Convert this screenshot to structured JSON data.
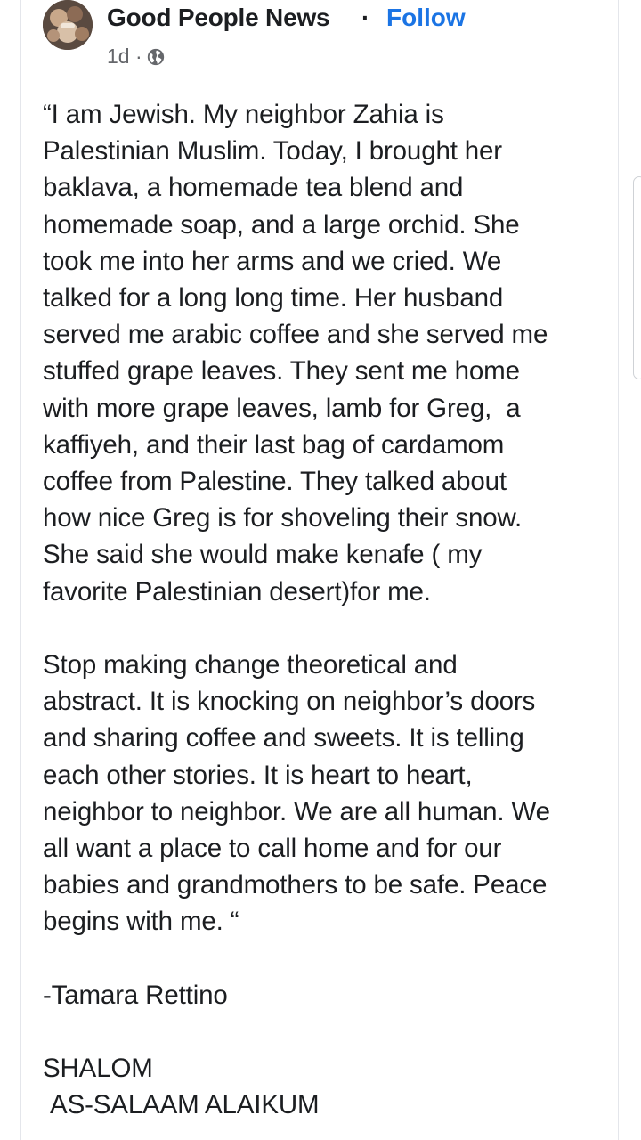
{
  "post": {
    "page_name": "Good People News",
    "separator": "·",
    "follow_label": "Follow",
    "time": "1d ·",
    "audience_icon": "globe-icon",
    "avatar_icon": "page-avatar-icon",
    "body": "“I am Jewish. My neighbor Zahia is\nPalestinian Muslim. Today, I brought her\nbaklava, a homemade tea blend and\nhomemade soap, and a large orchid. She\ntook me into her arms and we cried. We\ntalked for a long long time. Her husband\nserved me arabic coffee and she served me\nstuffed grape leaves. They sent me home\nwith more grape leaves, lamb for Greg,  a\nkaffiyeh, and their last bag of cardamom\ncoffee from Palestine. They talked about\nhow nice Greg is for shoveling their snow.\nShe said she would make kenafe ( my\nfavorite Palestinian desert)for me.\n\nStop making change theoretical and\nabstract. It is knocking on neighbor’s doors\nand sharing coffee and sweets. It is telling\neach other stories. It is heart to heart,\nneighbor to neighbor. We are all human. We\nall want a place to call home and for our\nbabies and grandmothers to be safe. Peace\nbegins with me. “\n\n-Tamara Rettino\n\nSHALOM\n AS-SALAAM ALAIKUM"
  },
  "colors": {
    "link": "#1b74e4",
    "text": "#1c1e21",
    "meta": "#65676b"
  }
}
